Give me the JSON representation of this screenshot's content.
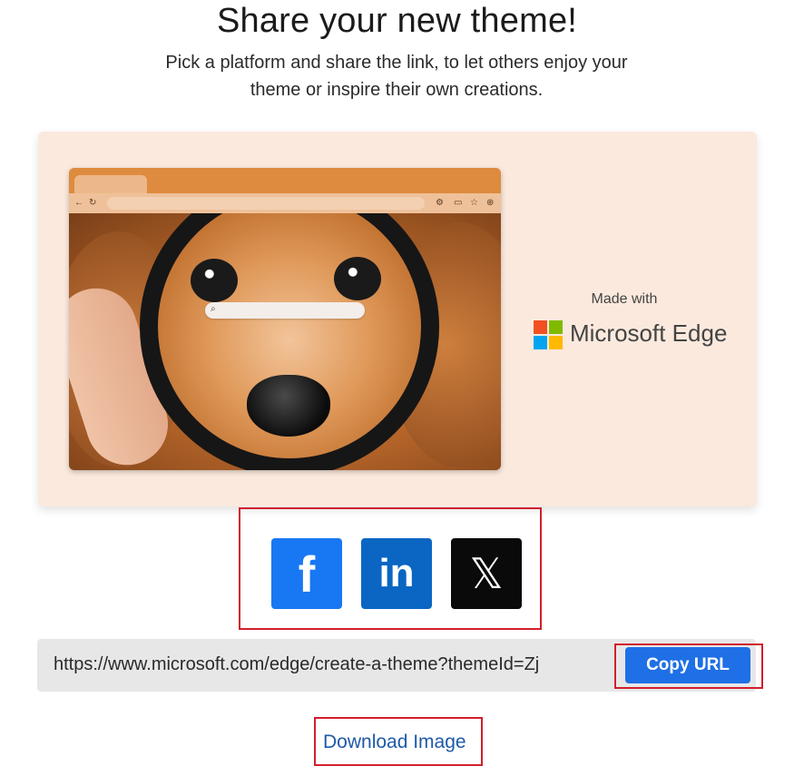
{
  "header": {
    "title": "Share your new theme!",
    "subtitle": "Pick a platform and share the link, to let others enjoy your theme or inspire their own creations."
  },
  "preview": {
    "made_with_label": "Made with",
    "brand_name": "Microsoft Edge",
    "brand_colors": [
      "#f25022",
      "#7fba00",
      "#00a4ef",
      "#ffb900"
    ],
    "browser_frame_color": "#de8b3f",
    "card_background": "#fbe9dd"
  },
  "share": {
    "facebook_glyph": "f",
    "linkedin_glyph": "in",
    "x_glyph": "𝕏",
    "facebook_color": "#1877f2",
    "linkedin_color": "#0a66c2",
    "x_color": "#0a0a0a"
  },
  "url_field": {
    "value": "https://www.microsoft.com/edge/create-a-theme?themeId=Zj",
    "copy_label": "Copy URL",
    "copy_color": "#1f6fe6"
  },
  "download": {
    "label": "Download Image"
  },
  "annotation_color": "#d21f2b"
}
